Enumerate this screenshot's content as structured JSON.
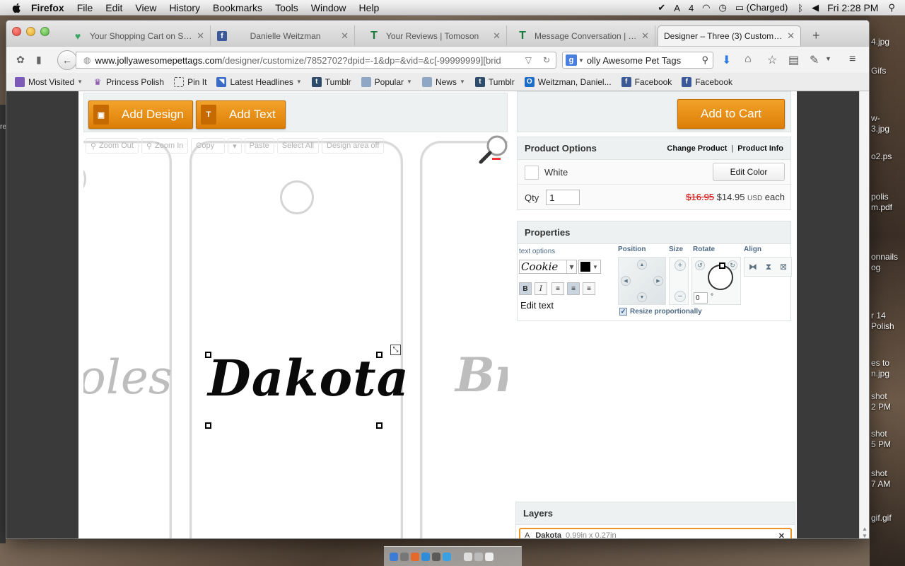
{
  "menubar": {
    "app": "Firefox",
    "items": [
      "File",
      "Edit",
      "View",
      "History",
      "Bookmarks",
      "Tools",
      "Window",
      "Help"
    ],
    "status": {
      "adobe_count": "4",
      "battery": "(Charged)",
      "clock": "Fri 2:28 PM"
    }
  },
  "tabs": [
    {
      "title": "Your Shopping Cart on St...",
      "icon": "heart-icon"
    },
    {
      "title": "Danielle Weitzman",
      "icon": "facebook-icon"
    },
    {
      "title": "Your Reviews | Tomoson",
      "icon": "tomoson-icon"
    },
    {
      "title": "Message Conversation | T...",
      "icon": "tomoson-icon"
    },
    {
      "title": "Designer – Three (3) Custom P...",
      "icon": "none",
      "active": true
    }
  ],
  "nav": {
    "url_domain": "www.jollyawesomepettags.com",
    "url_path": "/designer/customize/7852702?dpid=-1&dp=&vid=&c[-99999999][brid",
    "search_engine": "Google",
    "search_value": "olly Awesome Pet Tags"
  },
  "bookmarks": [
    {
      "label": "Most Visited",
      "icon": "folder-icon",
      "dropdown": true
    },
    {
      "label": "Princess Polish",
      "icon": "crown-icon"
    },
    {
      "label": "Pin It",
      "icon": "dashed-box-icon"
    },
    {
      "label": "Latest Headlines",
      "icon": "rss-icon",
      "dropdown": true
    },
    {
      "label": "Tumblr",
      "icon": "tumblr-icon"
    },
    {
      "label": "Popular",
      "icon": "folder-icon",
      "dropdown": true
    },
    {
      "label": "News",
      "icon": "folder-icon",
      "dropdown": true
    },
    {
      "label": "Tumblr",
      "icon": "tumblr-icon"
    },
    {
      "label": "Weitzman, Daniel...",
      "icon": "outlook-icon"
    },
    {
      "label": "Facebook",
      "icon": "facebook-icon"
    },
    {
      "label": "Facebook",
      "icon": "facebook-icon"
    }
  ],
  "designer": {
    "add_design": "Add Design",
    "add_text": "Add Text",
    "toolbar": {
      "zoom_out": "Zoom Out",
      "zoom_in": "Zoom In",
      "copy": "Copy",
      "paste": "Paste",
      "select_all": "Select All",
      "design_area": "Design area off"
    },
    "canvas": {
      "left_tag_text": "oles",
      "main_text": "Dakota",
      "right_tag_text": "Br"
    }
  },
  "cart": {
    "add_to_cart": "Add to Cart"
  },
  "product_options": {
    "title": "Product Options",
    "change_product": "Change Product",
    "separator": "|",
    "product_info": "Product Info",
    "color_name": "White",
    "edit_color": "Edit Color",
    "qty_label": "Qty",
    "qty_value": "1",
    "old_price": "$16.95",
    "new_price": "$14.95",
    "currency": "USD",
    "each": "each"
  },
  "properties": {
    "title": "Properties",
    "text_options": "text options",
    "font": "Cookie",
    "text_color": "#000000",
    "position": "Position",
    "size": "Size",
    "rotate": "Rotate",
    "align": "Align",
    "rotation_value": "0",
    "degree": "°",
    "edit_text": "Edit text",
    "resize_proportionally": "Resize proportionally",
    "bold": "B",
    "italic": "I"
  },
  "layers": {
    "title": "Layers",
    "item_name": "Dakota",
    "item_dims": "0.99in x 0.27in"
  },
  "desktop_labels": [
    "4.jpg",
    "Gifs",
    "w-",
    "3.jpg",
    "o2.ps",
    "polis",
    "m.pdf",
    "onnails",
    "og",
    "r 14",
    "Polish",
    "es to",
    "n.jpg",
    "shot",
    "2 PM",
    "shot",
    "5 PM",
    "shot",
    "7 AM",
    "gif.gif"
  ],
  "desktop_left_label": "re"
}
